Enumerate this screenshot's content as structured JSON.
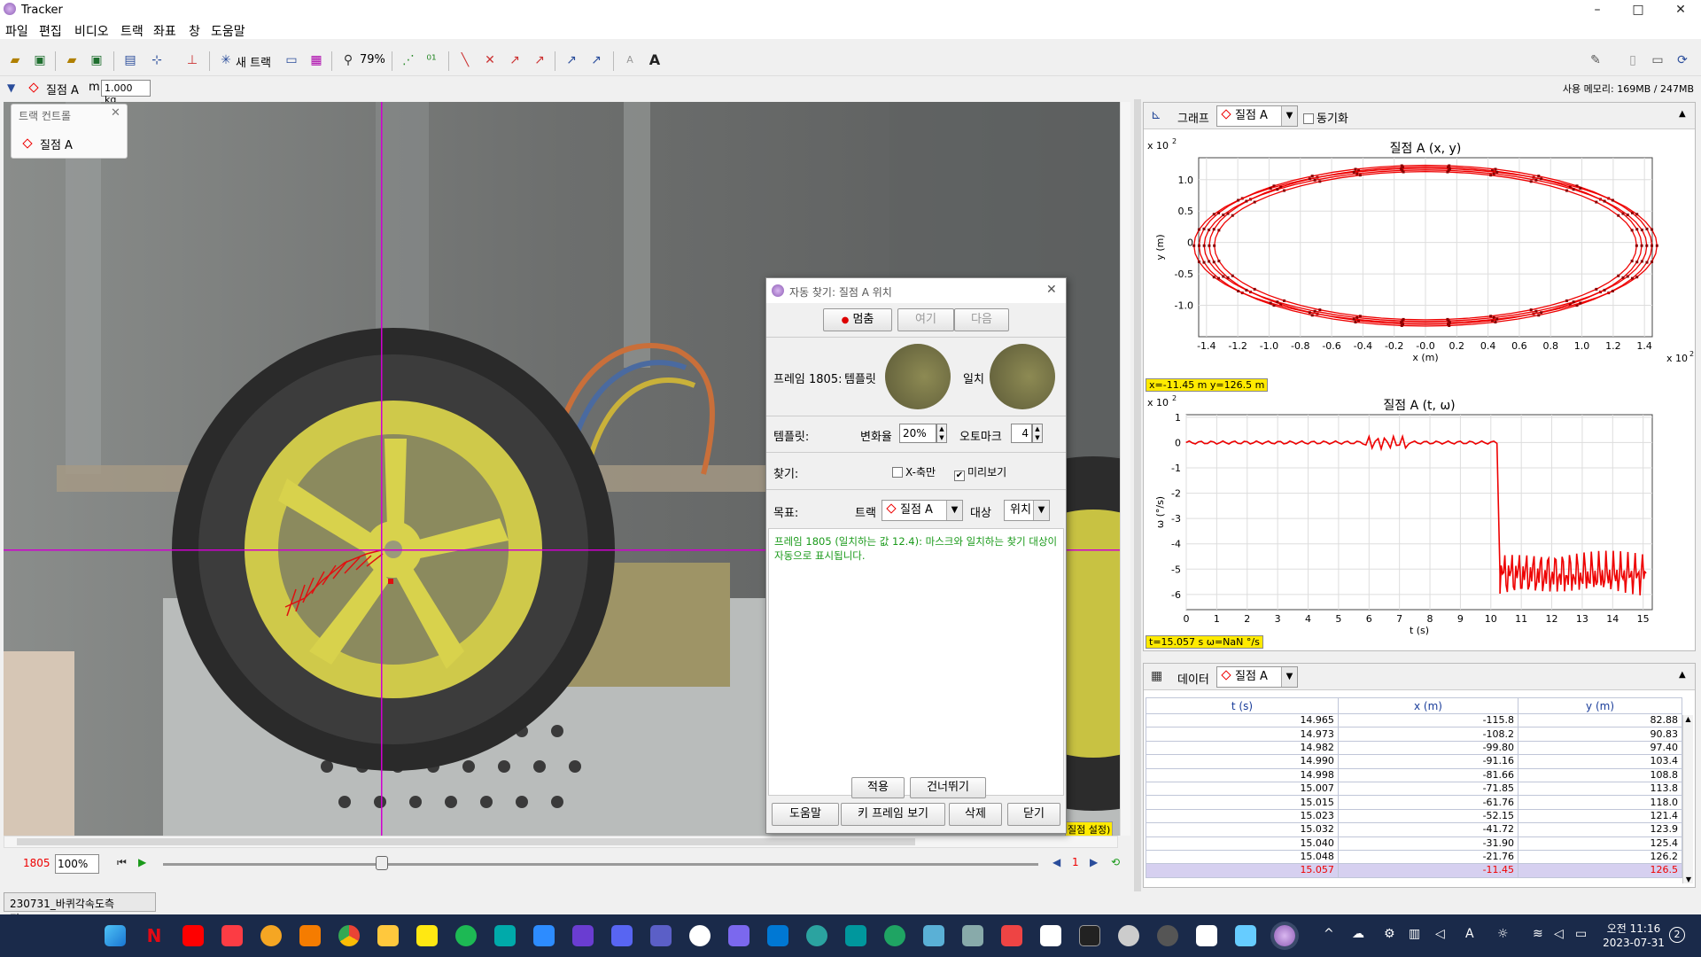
{
  "window": {
    "title": "Tracker",
    "min": "–",
    "max": "□",
    "close": "✕"
  },
  "menu": [
    "파일",
    "편집",
    "비디오",
    "트랙",
    "좌표",
    "창",
    "도움말"
  ],
  "toolbar": {
    "new_track": "새 트랙",
    "zoom": "79%"
  },
  "trackbar": {
    "track_name": "질점 A",
    "mass_label": "m",
    "mass_value": "1.000 kg",
    "memory": "사용 메모리: 169MB / 247MB"
  },
  "track_control": {
    "title": "트랙 컨트롤",
    "item": "질점 A"
  },
  "video_overlay": {
    "tag": "질점 설정)"
  },
  "playback": {
    "frame": "1805",
    "rate": "100%",
    "step": "1",
    "slider_fraction": 0.25
  },
  "file_tab": "230731_바퀴각속도측정.MP4",
  "autotracker": {
    "title": "자동 찾기: 질점 A 위치",
    "stop": "멈춤",
    "search": "여기",
    "next": "다음",
    "frame_label": "프레임 1805:",
    "template_label": "템플릿",
    "match_label": "일치",
    "template_row": "템플릿:",
    "evolve_label": "변화율",
    "evolve_value": "20%",
    "automark_label": "오토마크",
    "automark_value": "4",
    "search_row": "찾기:",
    "xaxis_only": "X-축만",
    "preview": "미리보기",
    "target_row": "목표:",
    "track_label": "트랙",
    "track_value": "질점 A",
    "target_label": "대상",
    "target_value": "위치",
    "message": "프레임 1805 (일치하는 값 12.4): 마스크와 일치하는 찾기 대상이 자동으로 표시됩니다.",
    "accept": "적용",
    "skip": "건너뛰기",
    "help": "도움말",
    "keyframes": "키 프레임 보기",
    "delete": "삭제",
    "close": "닫기"
  },
  "graph_panel": {
    "title": "그래프",
    "track": "질점 A",
    "sync": "동기화"
  },
  "plot1": {
    "title": "질점 A (x, y)",
    "xlabel": "x (m)",
    "ylabel": "y (m)",
    "scale_x": "x 10",
    "scale_y": "x 10",
    "exp": "2",
    "readout": "x=-11.45 m  y=126.5 m",
    "xticks": [
      "-1.4",
      "-1.2",
      "-1.0",
      "-0.8",
      "-0.6",
      "-0.4",
      "-0.2",
      "-0.0",
      "0.2",
      "0.4",
      "0.6",
      "0.8",
      "1.0",
      "1.2",
      "1.4"
    ],
    "yticks": [
      "1.0",
      "0.5",
      "0",
      "-0.5",
      "-1.0"
    ]
  },
  "plot2": {
    "title": "질점 A (t, ω)",
    "xlabel": "t (s)",
    "ylabel": "ω (°/s)",
    "scale_y": "x 10",
    "exp": "2",
    "readout": "t=15.057 s  ω=NaN °/s",
    "xticks": [
      "0",
      "1",
      "2",
      "3",
      "4",
      "5",
      "6",
      "7",
      "8",
      "9",
      "10",
      "11",
      "12",
      "13",
      "14",
      "15"
    ],
    "yticks": [
      "1",
      "0",
      "-1",
      "-2",
      "-3",
      "-4",
      "-5",
      "-6"
    ]
  },
  "chart_data": [
    {
      "type": "scatter",
      "title": "질점 A (x, y)",
      "xlabel": "x (m)",
      "ylabel": "y (m)",
      "xlim": [
        -145,
        145
      ],
      "ylim": [
        -150,
        135
      ],
      "description_series": {
        "shape": "ellipse",
        "center": [
          0,
          -5
        ],
        "rx_range": [
          135,
          148
        ],
        "ry_range": [
          118,
          128
        ],
        "loops": 5
      }
    },
    {
      "type": "line",
      "title": "질점 A (t, ω)",
      "xlabel": "t (s)",
      "ylabel": "ω (°/s)",
      "xlim": [
        0,
        15.3
      ],
      "ylim": [
        -660,
        110
      ],
      "segments": [
        {
          "t": [
            0,
            10.2
          ],
          "omega": 0
        },
        {
          "t": [
            10.3,
            15.1
          ],
          "omega_mean": -520,
          "omega_range": [
            -640,
            -400
          ]
        }
      ]
    }
  ],
  "data_panel": {
    "title": "데이터",
    "track": "질점 A",
    "columns": [
      "t (s)",
      "x (m)",
      "y (m)"
    ],
    "rows": [
      [
        "14.965",
        "-115.8",
        "82.88"
      ],
      [
        "14.973",
        "-108.2",
        "90.83"
      ],
      [
        "14.982",
        "-99.80",
        "97.40"
      ],
      [
        "14.990",
        "-91.16",
        "103.4"
      ],
      [
        "14.998",
        "-81.66",
        "108.8"
      ],
      [
        "15.007",
        "-71.85",
        "113.8"
      ],
      [
        "15.015",
        "-61.76",
        "118.0"
      ],
      [
        "15.023",
        "-52.15",
        "121.4"
      ],
      [
        "15.032",
        "-41.72",
        "123.9"
      ],
      [
        "15.040",
        "-31.90",
        "125.4"
      ],
      [
        "15.048",
        "-21.76",
        "126.2"
      ],
      [
        "15.057",
        "-11.45",
        "126.5"
      ]
    ]
  },
  "taskbar": {
    "time": "오전 11:16",
    "date": "2023-07-31",
    "badge": "2",
    "ime": "A"
  }
}
